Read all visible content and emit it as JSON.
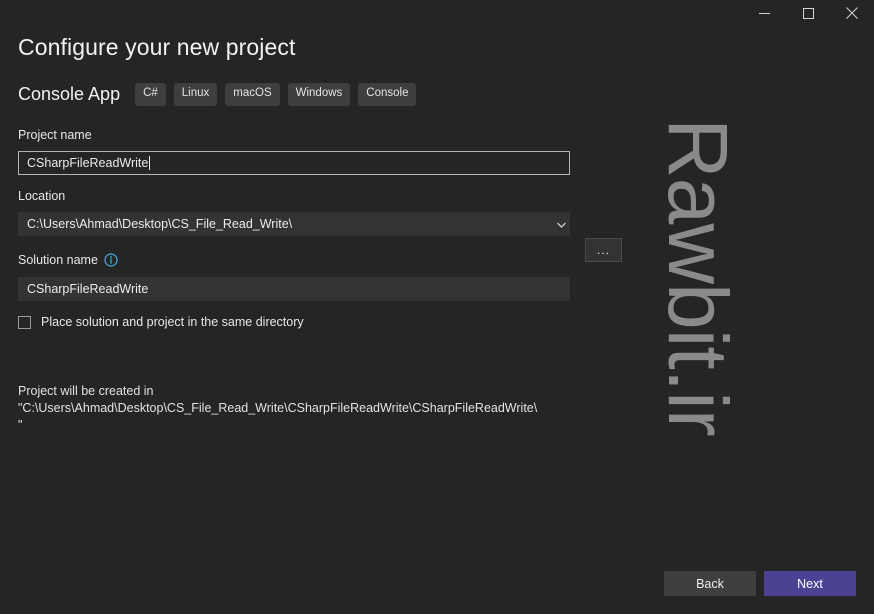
{
  "window": {
    "controls": [
      {
        "name": "minimize",
        "glyph": "minimize-icon"
      },
      {
        "name": "maximize",
        "glyph": "maximize-icon"
      },
      {
        "name": "close",
        "glyph": "close-icon"
      }
    ]
  },
  "watermark": {
    "text": "Rawbit.ir"
  },
  "page": {
    "title": "Configure your new project",
    "template_name": "Console App",
    "tags": [
      "C#",
      "Linux",
      "macOS",
      "Windows",
      "Console"
    ]
  },
  "fields": {
    "project_name": {
      "label": "Project name",
      "value": "CSharpFileReadWrite"
    },
    "location": {
      "label": "Location",
      "value": "C:\\Users\\Ahmad\\Desktop\\CS_File_Read_Write\\",
      "browse_label": "..."
    },
    "solution_name": {
      "label": "Solution name",
      "info_icon": "info-icon",
      "value": "CSharpFileReadWrite"
    },
    "same_directory": {
      "label": "Place solution and project in the same directory",
      "checked": false
    }
  },
  "note": {
    "text": "Project will be created in \"C:\\Users\\Ahmad\\Desktop\\CS_File_Read_Write\\CSharpFileReadWrite\\CSharpFileReadWrite\\\""
  },
  "footer": {
    "back_label": "Back",
    "next_label": "Next"
  },
  "colors": {
    "background": "#252526",
    "field_background": "#333334",
    "accent": "#4b4294",
    "info": "#41b0e4",
    "tag_background": "#3f3f41"
  }
}
